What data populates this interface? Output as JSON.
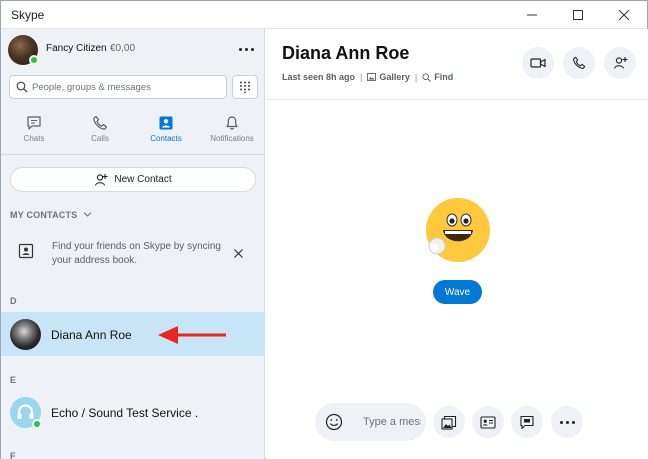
{
  "window": {
    "title": "Skype"
  },
  "profile": {
    "name": "Fancy Citizen",
    "credit": "€0,00"
  },
  "search": {
    "placeholder": "People, groups & messages"
  },
  "nav": {
    "tabs": [
      {
        "label": "Chats",
        "icon": "chat-icon"
      },
      {
        "label": "Calls",
        "icon": "phone-icon"
      },
      {
        "label": "Contacts",
        "icon": "contacts-icon",
        "active": true
      },
      {
        "label": "Notifications",
        "icon": "bell-icon"
      }
    ]
  },
  "new_contact": {
    "label": "New Contact"
  },
  "contacts_section": {
    "title": "MY CONTACTS",
    "sync_message": "Find your friends on Skype by syncing your address book."
  },
  "groups": [
    {
      "letter": "D",
      "contacts": [
        {
          "name": "Diana Ann Roe",
          "selected": true
        }
      ]
    },
    {
      "letter": "E",
      "contacts": [
        {
          "name": "Echo / Sound Test Service .",
          "online": true
        }
      ]
    },
    {
      "letter": "F"
    }
  ],
  "chat": {
    "title": "Diana Ann Roe",
    "last_seen": "Last seen 8h ago",
    "gallery_label": "Gallery",
    "find_label": "Find",
    "wave_label": "Wave",
    "compose_placeholder": "Type a message"
  },
  "colors": {
    "accent": "#0078d4",
    "selected_row": "#c7e5f6",
    "sidebar_bg": "#eef1f6",
    "online": "#2fbf4a",
    "arrow": "#e8281e"
  }
}
